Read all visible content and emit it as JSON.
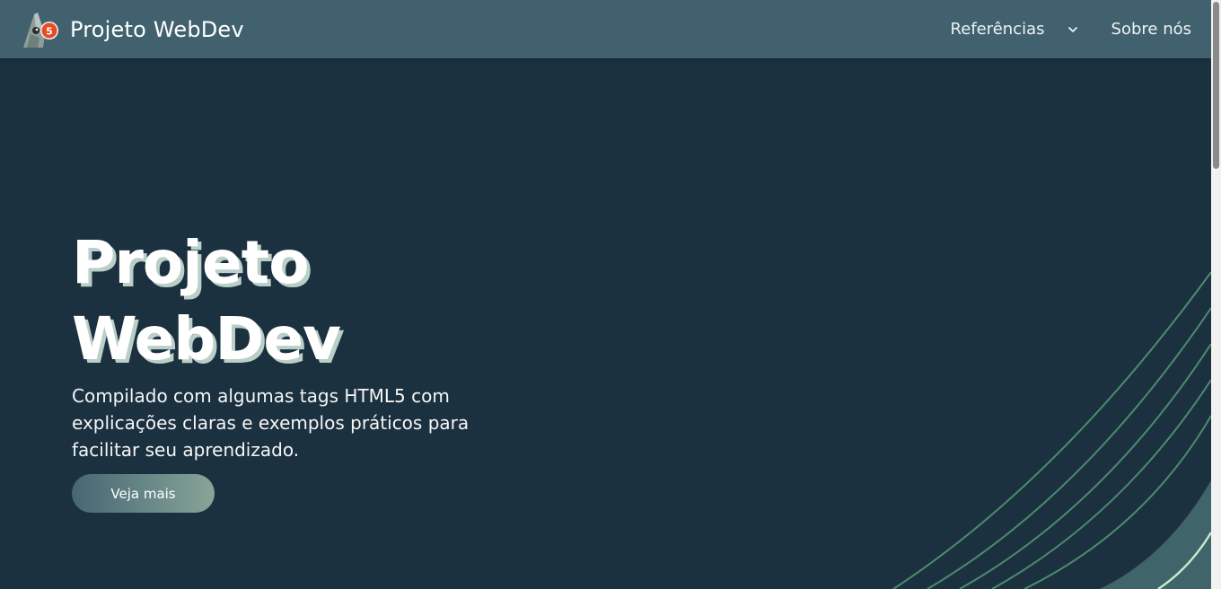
{
  "navbar": {
    "brand_title": "Projeto WebDev",
    "logo_badge": "5",
    "links": [
      {
        "label": "Referências",
        "icon": "chevron-down-icon"
      },
      {
        "label": "Sobre nós"
      }
    ]
  },
  "hero": {
    "title": "Projeto WebDev",
    "description": "Compilado com algumas tags HTML5 com explicações claras e exemplos práticos para facilitar seu aprendizado.",
    "button_label": "Veja mais"
  },
  "colors": {
    "navbar": "#41616f",
    "background": "#1c3140",
    "title_shadow": "#b9cfc7",
    "button_gradient_start": "#466673",
    "button_gradient_end": "#87a598",
    "deco_lines": "#4d8a6f"
  }
}
